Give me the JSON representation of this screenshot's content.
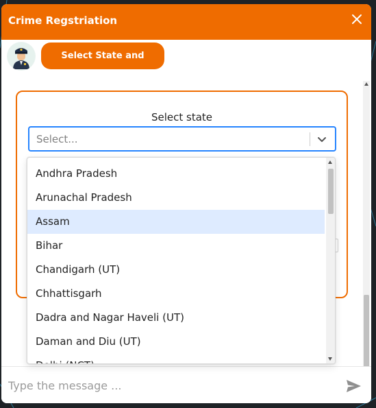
{
  "header": {
    "title": "Crime Regstriation",
    "close_icon": "close-icon"
  },
  "bot_message": {
    "avatar_icon": "police-officer-avatar",
    "text": "Select State and District:"
  },
  "form": {
    "state_label": "Select state",
    "state_placeholder": "Select...",
    "chevron_icon": "chevron-down-icon"
  },
  "dropdown": {
    "options": [
      "Andhra Pradesh",
      "Arunachal Pradesh",
      "Assam",
      "Bihar",
      "Chandigarh (UT)",
      "Chhattisgarh",
      "Dadra and Nagar Haveli (UT)",
      "Daman and Diu (UT)",
      "Delhi (NCT)"
    ],
    "focused_option": "Assam"
  },
  "footer": {
    "placeholder": "Type the message ...",
    "send_icon": "send-icon"
  },
  "colors": {
    "accent": "#ef6c00",
    "focus_border": "#2684ff",
    "option_focus_bg": "#deebff"
  }
}
